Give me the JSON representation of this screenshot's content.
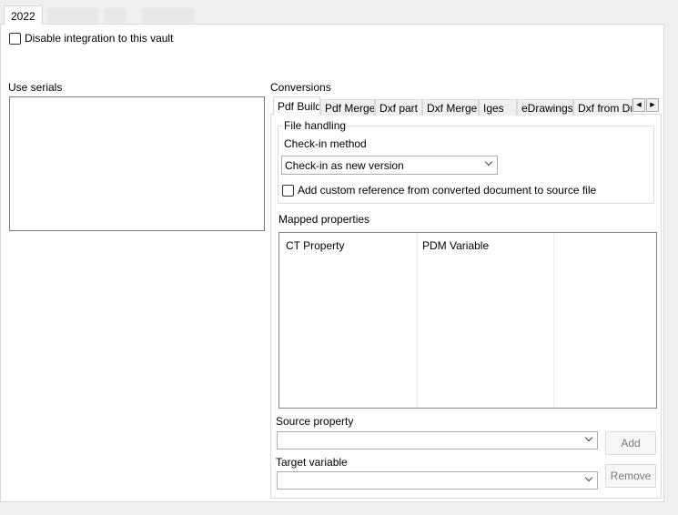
{
  "top_tabs": {
    "active_label": "2022"
  },
  "vault": {
    "disable_integration_label": "Disable integration to this vault",
    "disable_integration_checked": false
  },
  "serials": {
    "label": "Use serials"
  },
  "conversions": {
    "label": "Conversions",
    "tabs": [
      "Pdf Build",
      "Pdf Merge",
      "Dxf part",
      "Dxf Merge",
      "Iges",
      "eDrawings",
      "Dxf from Dra"
    ],
    "active_tab": "Pdf Build",
    "file_handling": {
      "group_title": "File handling",
      "checkin_label": "Check-in method",
      "checkin_value": "Check-in as new version",
      "custom_ref_label": "Add custom reference from converted document to source file",
      "custom_ref_checked": false
    },
    "mapped_properties": {
      "label": "Mapped properties",
      "columns": [
        "CT Property",
        "PDM Variable",
        ""
      ]
    },
    "source_property": {
      "label": "Source property",
      "value": ""
    },
    "target_variable": {
      "label": "Target variable",
      "value": ""
    },
    "buttons": {
      "add": "Add",
      "remove": "Remove"
    }
  }
}
